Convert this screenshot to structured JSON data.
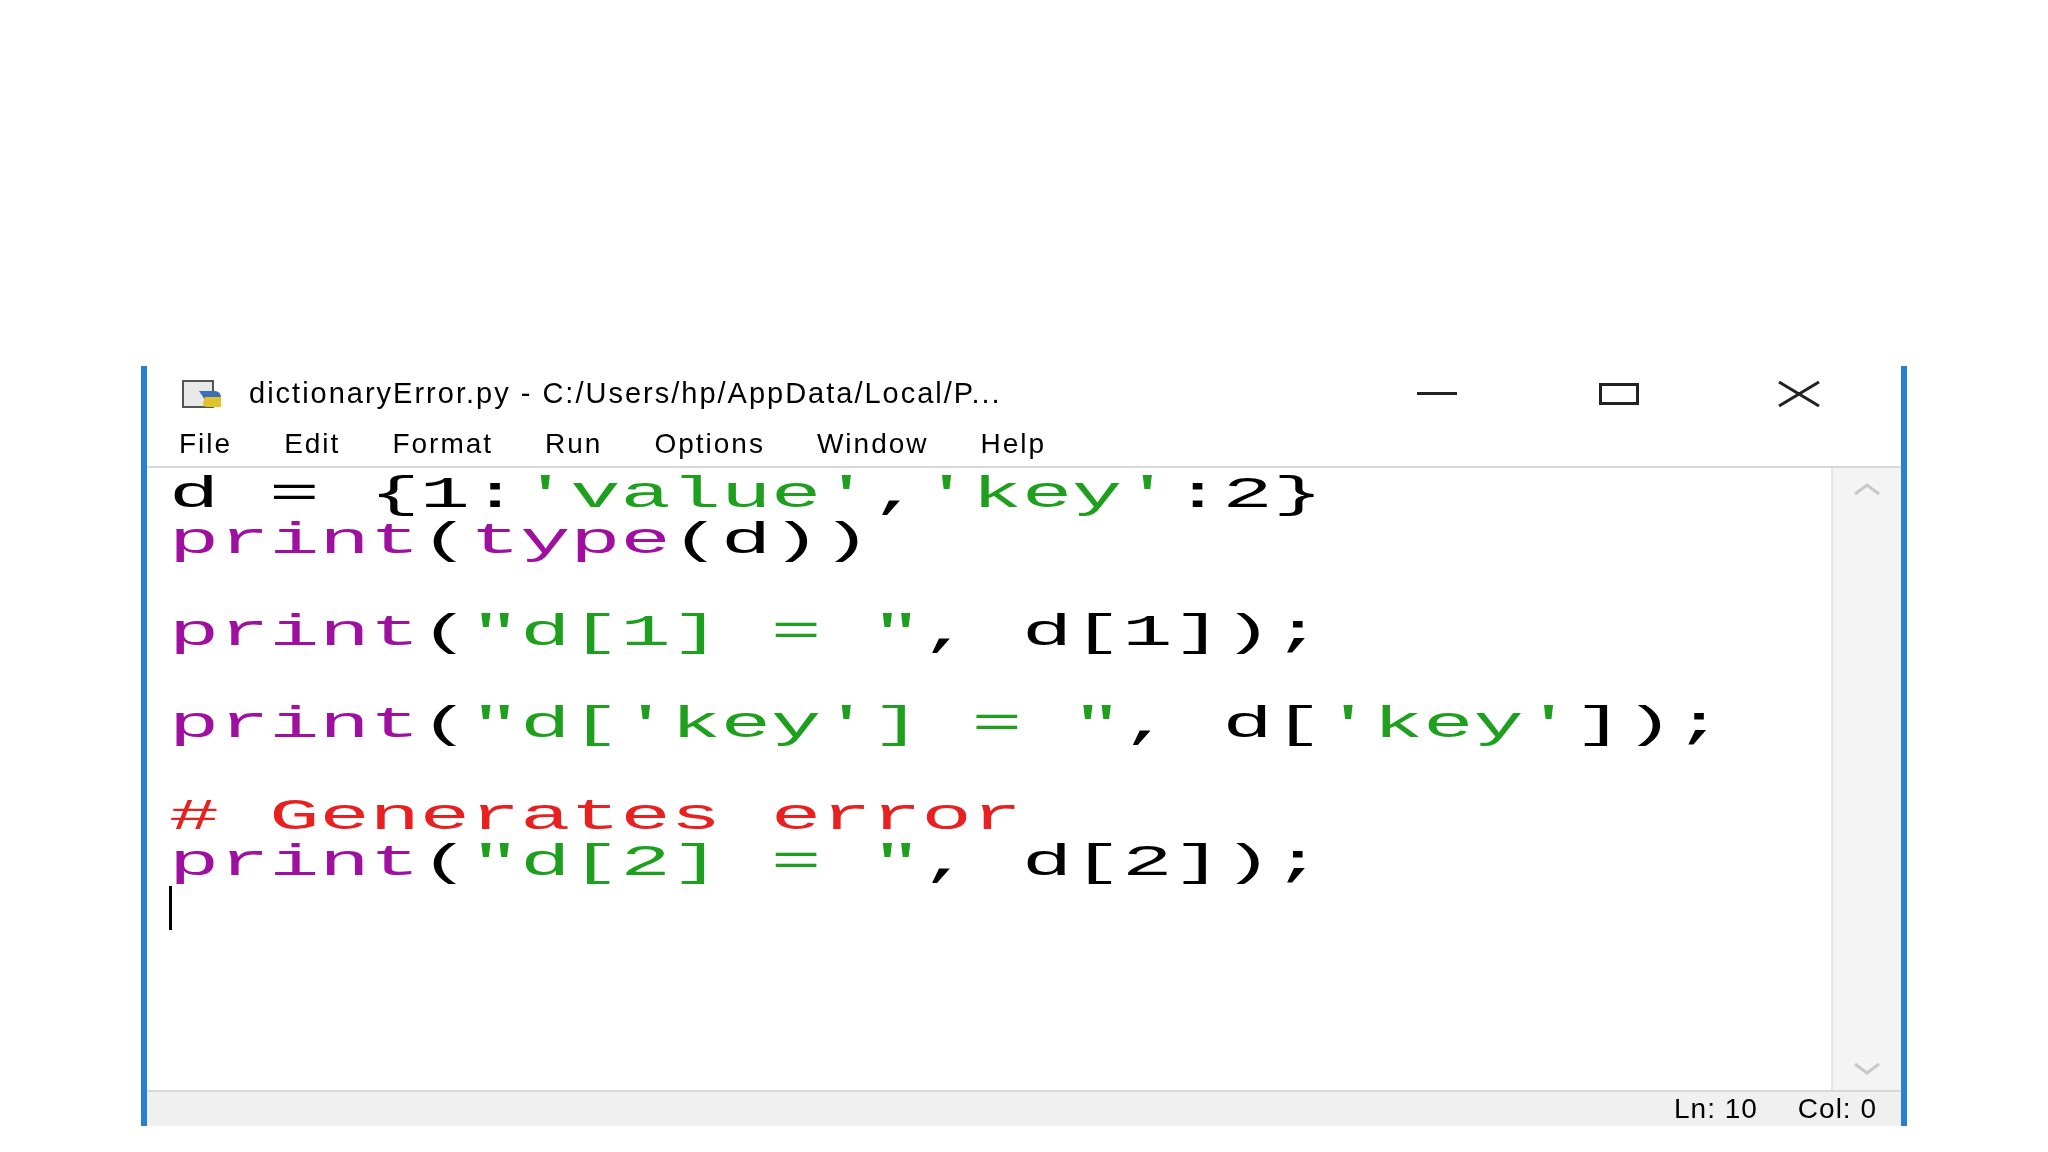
{
  "window": {
    "title": "dictionaryError.py - C:/Users/hp/AppData/Local/P..."
  },
  "menu": [
    "File",
    "Edit",
    "Format",
    "Run",
    "Options",
    "Window",
    "Help"
  ],
  "editor": {
    "lines": [
      {
        "kind": "code",
        "tokens": [
          {
            "kind": "plain",
            "text": "d = {1:"
          },
          {
            "kind": "string",
            "text": "'value'"
          },
          {
            "kind": "plain",
            "text": ","
          },
          {
            "kind": "string",
            "text": "'key'"
          },
          {
            "kind": "plain",
            "text": ":2}"
          }
        ]
      },
      {
        "kind": "code",
        "tokens": [
          {
            "kind": "builtin",
            "text": "print"
          },
          {
            "kind": "plain",
            "text": "("
          },
          {
            "kind": "builtin",
            "text": "type"
          },
          {
            "kind": "plain",
            "text": "(d))"
          }
        ]
      },
      {
        "kind": "blank"
      },
      {
        "kind": "code",
        "tokens": [
          {
            "kind": "builtin",
            "text": "print"
          },
          {
            "kind": "plain",
            "text": "("
          },
          {
            "kind": "string",
            "text": "\"d[1] = \""
          },
          {
            "kind": "plain",
            "text": ", d[1]);"
          }
        ]
      },
      {
        "kind": "blank"
      },
      {
        "kind": "code",
        "tokens": [
          {
            "kind": "builtin",
            "text": "print"
          },
          {
            "kind": "plain",
            "text": "("
          },
          {
            "kind": "string",
            "text": "\"d['key'] = \""
          },
          {
            "kind": "plain",
            "text": ", d["
          },
          {
            "kind": "string",
            "text": "'key'"
          },
          {
            "kind": "plain",
            "text": "]);"
          }
        ]
      },
      {
        "kind": "blank"
      },
      {
        "kind": "code",
        "tokens": [
          {
            "kind": "comment",
            "text": "# Generates error"
          }
        ]
      },
      {
        "kind": "code",
        "tokens": [
          {
            "kind": "builtin",
            "text": "print"
          },
          {
            "kind": "plain",
            "text": "("
          },
          {
            "kind": "string",
            "text": "\"d[2] = \""
          },
          {
            "kind": "plain",
            "text": ", d[2]);"
          }
        ]
      }
    ]
  },
  "status_bar": {
    "line": "Ln: 10",
    "column": "Col: 0"
  }
}
